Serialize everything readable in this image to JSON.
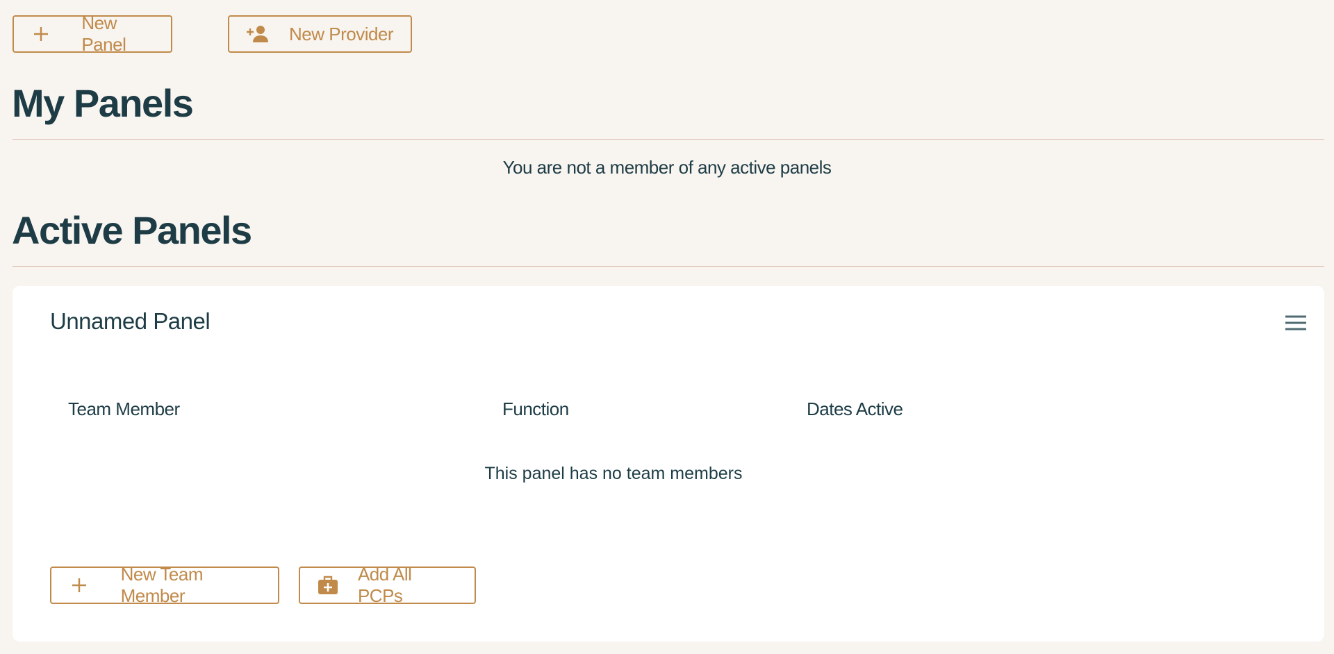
{
  "toolbar": {
    "new_panel_label": "New Panel",
    "new_provider_label": "New Provider"
  },
  "my_panels": {
    "title": "My Panels",
    "empty_message": "You are not a member of any active panels"
  },
  "active_panels": {
    "title": "Active Panels",
    "panels": [
      {
        "name": "Unnamed Panel",
        "columns": [
          "Team Member",
          "Function",
          "Dates Active"
        ],
        "empty_message": "This panel has no team members",
        "new_team_member_label": "New Team Member",
        "add_all_pcps_label": "Add All PCPs"
      }
    ]
  },
  "colors": {
    "accent": "#c08a4a",
    "text": "#1d3c45",
    "background": "#f8f4f0",
    "card": "#ffffff",
    "divider": "#d9b9a8"
  },
  "icons": {
    "new_panel": "plus-icon",
    "new_provider": "person-add-icon",
    "card_menu": "hamburger-menu-icon",
    "new_team_member": "plus-icon",
    "add_all_pcps": "medical-bag-icon"
  }
}
